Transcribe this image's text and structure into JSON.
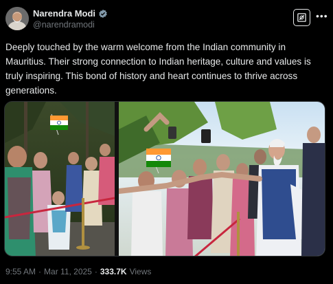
{
  "author": {
    "display_name": "Narendra Modi",
    "handle": "@narendramodi",
    "verified": true
  },
  "tweet": {
    "text": "Deeply touched by the warm welcome from the Indian community in Mauritius. Their strong connection to Indian heritage, culture and values is truly inspiring. This bond of history and heart continues to thrive across generations."
  },
  "media": {
    "count": 2,
    "nav_icon": "arrow-left-icon"
  },
  "meta": {
    "time": "9:55 AM",
    "separator": "·",
    "date": "Mar 11, 2025",
    "views_count": "333.7K",
    "views_label": "Views"
  },
  "icons": {
    "verified": "verified-badge-icon",
    "grok": "grok-icon",
    "more": "more-icon"
  },
  "colors": {
    "background": "#000000",
    "text": "#e7e9ea",
    "secondary": "#71767b",
    "border": "#2f3336"
  }
}
